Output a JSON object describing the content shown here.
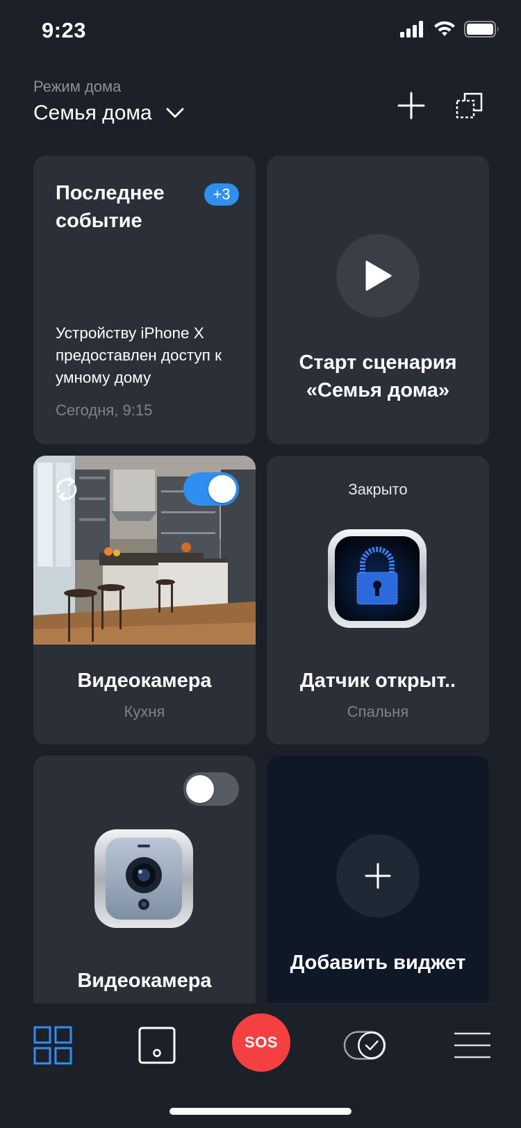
{
  "status_bar": {
    "time": "9:23"
  },
  "header": {
    "mode_label": "Режим дома",
    "mode_value": "Семья дома"
  },
  "cards": {
    "event": {
      "title": "Последнее событие",
      "badge": "+3",
      "text": "Устройству iPhone X предоставлен доступ к умному дому",
      "time": "Сегодня, 9:15"
    },
    "scenario": {
      "title": "Старт сценария «Семья дома»"
    },
    "camera_kitchen": {
      "title": "Видеокамера",
      "subtitle": "Кухня",
      "enabled": true
    },
    "door_sensor": {
      "status": "Закрыто",
      "title": "Датчик открыт..",
      "subtitle": "Спальня"
    },
    "camera_2": {
      "title": "Видеокамера",
      "enabled": false
    },
    "add_widget": {
      "title": "Добавить виджет"
    }
  },
  "tabbar": {
    "sos_label": "SOS",
    "active_tab": "dashboard",
    "active_color": "#2f8ff0"
  }
}
